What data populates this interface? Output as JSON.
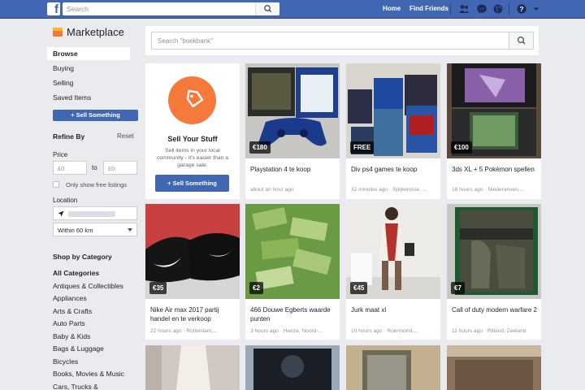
{
  "topbar": {
    "logo": "f",
    "search_placeholder": "Search",
    "home": "Home",
    "find_friends": "Find Friends"
  },
  "sidebar": {
    "title": "Marketplace",
    "nav": [
      "Browse",
      "Buying",
      "Selling",
      "Saved Items"
    ],
    "sell_button": "+ Sell Something",
    "refine_by": "Refine By",
    "reset": "Reset",
    "price_label": "Price",
    "price_min_placeholder": "£0",
    "to": "to",
    "price_max_placeholder": "£0",
    "free_only": "Only show free listings",
    "location_label": "Location",
    "radius": "Within 60 km",
    "shop_by_category": "Shop by Category",
    "categories": [
      "All Categories",
      "Antiques & Collectibles",
      "Appliances",
      "Arts & Crafts",
      "Auto Parts",
      "Baby & Kids",
      "Bags & Luggage",
      "Bicycles",
      "Books, Movies & Music",
      "Cars, Trucks &"
    ]
  },
  "main": {
    "search_placeholder": "Search \"boekbank\"",
    "sell_card": {
      "title": "Sell Your Stuff",
      "desc": "Sell items in your local community - it's easier than a garage sale.",
      "button": "+ Sell Something"
    },
    "listings": [
      {
        "price": "€180",
        "title": "Playstation 4 te koop",
        "meta": "about an hour ago"
      },
      {
        "price": "FREE",
        "title": "Div ps4 games te koop",
        "meta": "32 minutes ago · Spijkenisse, ..."
      },
      {
        "price": "€100",
        "title": "3ds XL + 5 Pokémon spellen",
        "meta": "18 hours ago · Niederanven,..."
      },
      {
        "price": "€35",
        "title": "Nike Air max 2017 partij handel en te verkoop",
        "meta": "22 hours ago · Rotterdam,..."
      },
      {
        "price": "€2",
        "title": "466 Douwe Egberts waarde punten",
        "meta": "3 hours ago · Heeze, Noord-..."
      },
      {
        "price": "€45",
        "title": "Jurk maat xl",
        "meta": "10 hours ago · Roermond,..."
      },
      {
        "price": "€7",
        "title": "Call of duty modern warfare 2",
        "meta": "11 hours ago · Rilland, Zeeland"
      }
    ]
  },
  "colors": {
    "brand": "#4267b2",
    "accent": "#f5793a",
    "background": "#e9ebee"
  }
}
